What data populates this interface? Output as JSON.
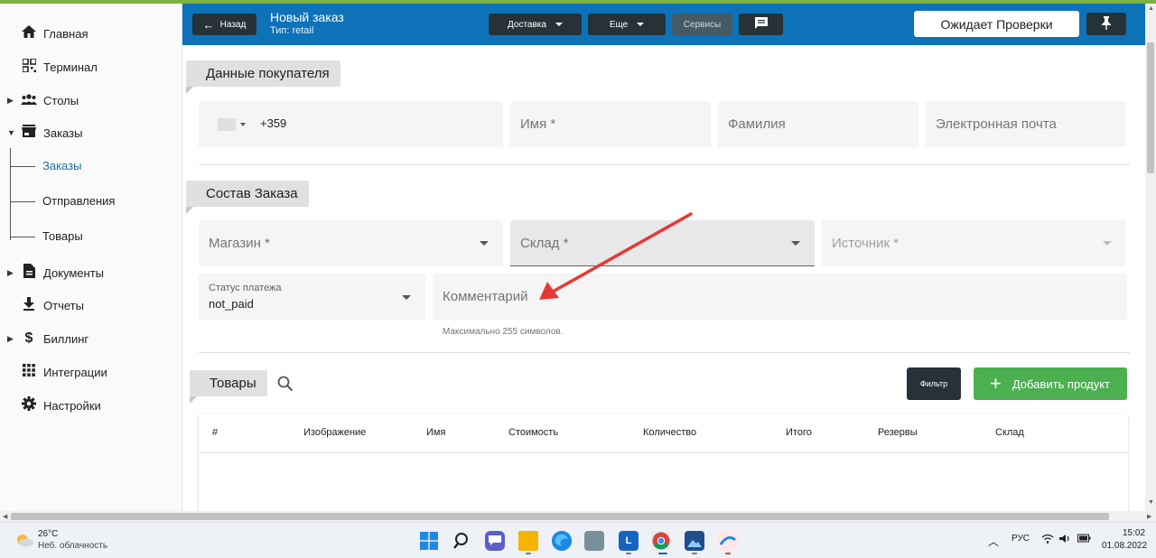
{
  "sidebar": {
    "items": [
      {
        "label": "Главная",
        "icon": "home-icon"
      },
      {
        "label": "Терминал",
        "icon": "qr-icon"
      },
      {
        "label": "Столы",
        "icon": "people-icon"
      },
      {
        "label": "Заказы",
        "icon": "store-icon"
      },
      {
        "label": "Документы",
        "icon": "document-icon"
      },
      {
        "label": "Отчеты",
        "icon": "download-icon"
      },
      {
        "label": "Биллинг",
        "icon": "dollar-icon"
      },
      {
        "label": "Интеграции",
        "icon": "apps-grid-icon"
      },
      {
        "label": "Настройки",
        "icon": "gear-icon"
      }
    ],
    "sub_items": [
      {
        "label": "Заказы",
        "active": true
      },
      {
        "label": "Отправления",
        "active": false
      },
      {
        "label": "Товары",
        "active": false
      }
    ]
  },
  "header": {
    "back_label": "Назад",
    "title": "Новый заказ",
    "subtitle": "Тип: retail",
    "delivery_label": "Доставка",
    "more_label": "Еще",
    "services_label": "Сервисы",
    "status_label": "Ожидает Проверки"
  },
  "customer": {
    "section_title": "Данные покупателя",
    "phone_code": "+359",
    "first_name_placeholder": "Имя *",
    "last_name_placeholder": "Фамилия",
    "email_placeholder": "Электронная почта"
  },
  "order": {
    "section_title": "Состав Заказа",
    "store_placeholder": "Магазин *",
    "warehouse_placeholder": "Склад *",
    "source_placeholder": "Источник *",
    "payment_status_label": "Статус платежа",
    "payment_status_value": "not_paid",
    "comment_placeholder": "Комментарий",
    "comment_hint": "Максимально 255 символов."
  },
  "products": {
    "section_title": "Товары",
    "filter_label": "Фильтр",
    "add_label": "Добавить продукт",
    "columns": [
      "#",
      "Изображение",
      "Имя",
      "Стоимость",
      "Количество",
      "Итого",
      "Резервы",
      "Склад"
    ]
  },
  "taskbar": {
    "weather_temp": "26°C",
    "weather_desc": "Неб. облачность",
    "lang": "РУС",
    "time": "15:02",
    "date": "01.08.2022"
  },
  "colors": {
    "header_bg": "#0d72b8",
    "add_button": "#4caf50",
    "annotation_arrow": "#e53935",
    "active_link": "#1e6fa8"
  }
}
